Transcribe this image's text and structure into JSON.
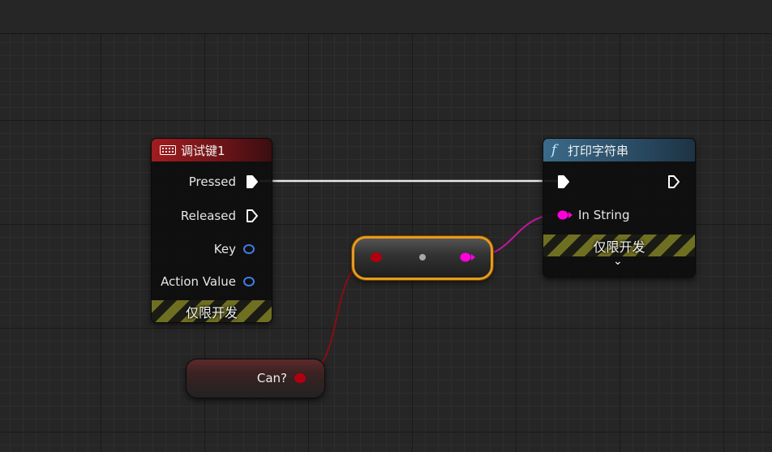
{
  "colors": {
    "exec": "#ffffff",
    "bool": "#b00010",
    "string": "#ff00dd",
    "struct": "#3d7ee6",
    "selection": "#e89a1a"
  },
  "debug_key_node": {
    "icon": "keyboard-icon",
    "title": "调试键1",
    "pins": {
      "pressed": "Pressed",
      "released": "Released",
      "key": "Key",
      "action_value": "Action Value"
    },
    "dev_only": "仅限开发"
  },
  "print_string_node": {
    "icon": "function-icon",
    "icon_glyph": "f",
    "title": "打印字符串",
    "pins": {
      "in_string": "In String"
    },
    "dev_only": "仅限开发",
    "expand_glyph": "⌄"
  },
  "variable_node": {
    "label": "Can?"
  }
}
